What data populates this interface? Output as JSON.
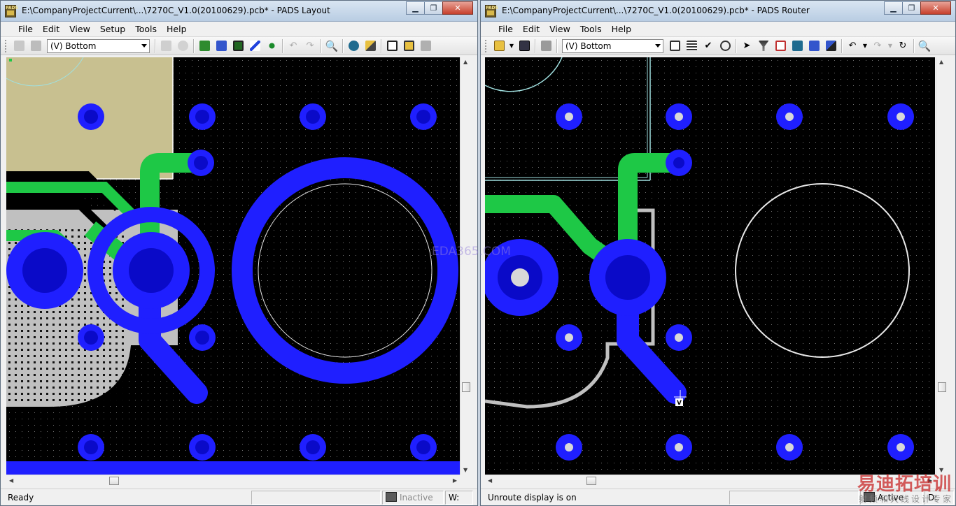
{
  "colors": {
    "board_bg": "#000000",
    "grid_dot": "#6e6e6e",
    "pad_blue": "#1f1fff",
    "pad_dark": "#0a0ac8",
    "trace_green": "#1ec846",
    "copper_gray": "#c0c0c0",
    "outline_cyan": "#a0e0e0",
    "keepout_tan": "#c8c090"
  },
  "left": {
    "title": "E:\\CompanyProjectCurrent\\...\\7270C_V1.0(20100629).pcb* - PADS Layout",
    "caption_buttons": [
      "minimize",
      "maximize",
      "close"
    ],
    "menu": [
      "File",
      "Edit",
      "View",
      "Setup",
      "Tools",
      "Help"
    ],
    "layer": "(V) Bottom",
    "status": {
      "message": "Ready",
      "mode": "Inactive",
      "width_label": "W:"
    }
  },
  "right": {
    "title": "E:\\CompanyProjectCurrent\\...\\7270C_V1.0(20100629).pcb* - PADS Router",
    "caption_buttons": [
      "minimize",
      "maximize",
      "close"
    ],
    "menu": [
      "File",
      "Edit",
      "View",
      "Tools",
      "Help"
    ],
    "layer": "(V) Bottom",
    "cursor_tag": "V",
    "status": {
      "message": "Unroute display is on",
      "mode": "Active",
      "d_label": "D:"
    }
  },
  "watermarks": {
    "center": "EDA365.COM",
    "corner_main": "易迪拓培训",
    "corner_sub": "射频和天线设计专家"
  },
  "app_icon_text": "PADS"
}
